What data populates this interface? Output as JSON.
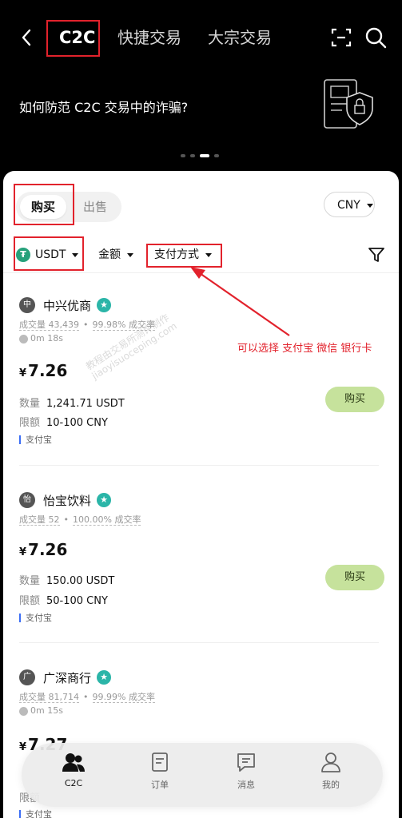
{
  "header": {
    "tabs": [
      {
        "label": "C2C",
        "active": true
      },
      {
        "label": "快捷交易",
        "active": false
      },
      {
        "label": "大宗交易",
        "active": false
      }
    ],
    "icons": [
      "back-arrow-icon",
      "scan-icon",
      "search-icon"
    ]
  },
  "banner": {
    "text": "如何防范 C2C 交易中的诈骗?",
    "page_count": 4,
    "active_page": 3
  },
  "trade_mode": {
    "buy_label": "购买",
    "sell_label": "出售",
    "selected": "购买"
  },
  "currency": {
    "selected": "CNY"
  },
  "filters": {
    "coin": "USDT",
    "amount": "金额",
    "payment": "支付方式"
  },
  "annotation": {
    "text": "可以选择 支付宝 微信 银行卡",
    "watermark_line1": "教程由交易所测评制作",
    "watermark_line2": "jiaoyisuoceping.com"
  },
  "listings": [
    {
      "avatar": "中",
      "merchant": "中兴优商",
      "volume": "成交量 43,439",
      "rate": "99.98% 成交率",
      "time": "0m 18s",
      "currency_symbol": "¥",
      "price": "7.26",
      "qty_label": "数量",
      "qty": "1,241.71 USDT",
      "limit_label": "限额",
      "limit": "10-100 CNY",
      "payment": "支付宝",
      "action": "购买"
    },
    {
      "avatar": "怡",
      "merchant": "怡宝饮料",
      "volume": "成交量 52",
      "rate": "100.00% 成交率",
      "time": "",
      "currency_symbol": "¥",
      "price": "7.26",
      "qty_label": "数量",
      "qty": "150.00 USDT",
      "limit_label": "限额",
      "limit": "50-100 CNY",
      "payment": "支付宝",
      "action": "购买"
    },
    {
      "avatar": "广",
      "merchant": "广深商行",
      "volume": "成交量 81,714",
      "rate": "99.99% 成交率",
      "time": "0m 15s",
      "currency_symbol": "¥",
      "price": "7.27",
      "qty_label": "限额",
      "qty": "",
      "limit_label": "",
      "limit": "",
      "payment": "支付宝",
      "action": ""
    }
  ],
  "bottom_nav": [
    {
      "label": "C2C",
      "icon": "people-icon",
      "active": true
    },
    {
      "label": "订单",
      "icon": "order-icon",
      "active": false
    },
    {
      "label": "消息",
      "icon": "message-icon",
      "active": false
    },
    {
      "label": "我的",
      "icon": "profile-icon",
      "active": false
    }
  ],
  "colors": {
    "background_dark": "#000000",
    "sheet": "#ffffff",
    "buy_button": "#c6e29c",
    "verified_badge": "#2bb5a8",
    "annotation_red": "#e2222c"
  }
}
